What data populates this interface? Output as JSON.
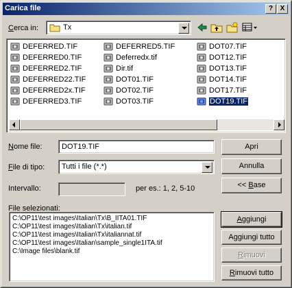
{
  "window": {
    "title": "Carica file",
    "help_glyph": "?",
    "close_glyph": "X"
  },
  "look_in": {
    "label_prefix": "C",
    "label_rest": "erca in:",
    "value": "Tx"
  },
  "toolbar": {
    "icons": [
      "back-arrow-icon",
      "up-folder-icon",
      "new-folder-icon",
      "view-menu-icon"
    ]
  },
  "files": {
    "columns": [
      [
        "DEFERRED.TIF",
        "DEFERRED0.TIF",
        "DEFERRED2.TIF",
        "DEFERRED22.TIF",
        "DEFERRED2x.TIF",
        "DEFERRED3.TIF"
      ],
      [
        "DEFERRED5.TIF",
        "Deferredx.tif",
        "Dir.tif",
        "DOT01.TIF",
        "DOT02.TIF",
        "DOT03.TIF"
      ],
      [
        "DOT07.TIF",
        "DOT12.TIF",
        "DOT13.TIF",
        "DOT14.TIF",
        "DOT17.TIF",
        "DOT19.TIF"
      ]
    ],
    "selected": "DOT19.TIF"
  },
  "filename": {
    "label_prefix": "N",
    "label_rest": "ome file:",
    "value": "DOT19.TIF"
  },
  "filetype": {
    "label_prefix": "F",
    "label_rest": "ile di tipo:",
    "value": "Tutti i file (*.*)"
  },
  "interval": {
    "label": "Intervallo:",
    "value": "",
    "hint": "per es.: 1, 2, 5-10"
  },
  "buttons": {
    "open": "Apri",
    "cancel": "Annulla",
    "base_prefix": "<< ",
    "base_accel": "B",
    "base_rest": "ase",
    "add_accel": "A",
    "add_rest": "ggiungi",
    "add_all": "Aggiungi tutto",
    "remove_accel": "R",
    "remove_rest": "imuovi",
    "remove_all_accel": "R",
    "remove_all_rest": "imuovi tutto"
  },
  "selected_files": {
    "label": "File selezionati:",
    "items": [
      "C:\\OP11\\test images\\Italian\\Tx\\B_IITA01.TIF",
      "C:\\OP11\\test images\\Italian\\Tx\\italian.tif",
      "C:\\OP11\\test images\\Italian\\Tx\\italiannat.tif",
      "C:\\OP11\\test images\\Italian\\sample_single1ITA.tif",
      "C:\\Image files\\blank.tif"
    ]
  }
}
